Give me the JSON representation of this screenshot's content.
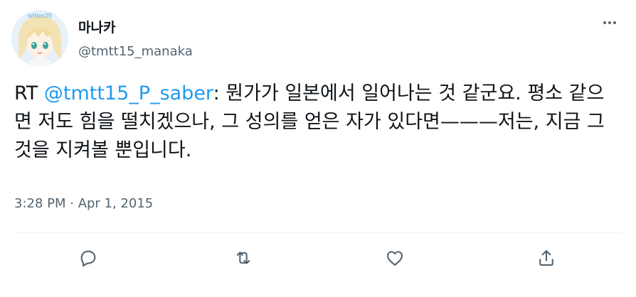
{
  "user": {
    "display_name": "마나카",
    "handle": "@tmtt15_manaka",
    "avatar_badge": "witter20"
  },
  "tweet": {
    "prefix": "RT ",
    "mention": "@tmtt15_P_saber",
    "body": ": 뭔가가 일본에서 일어나는 것 같군요. 평소 같으면 저도 힘을 떨치겠으나, 그 성의를 얻은 자가 있다면———저는, 지금 그것을 지켜볼 뿐입니다."
  },
  "meta": {
    "timestamp": "3:28 PM · Apr 1, 2015"
  },
  "actions": [
    {
      "name": "reply",
      "icon": "reply-icon"
    },
    {
      "name": "retweet",
      "icon": "retweet-icon"
    },
    {
      "name": "like",
      "icon": "heart-icon"
    },
    {
      "name": "share",
      "icon": "share-icon"
    }
  ],
  "colors": {
    "link": "#1d9bf0",
    "text": "#0f1419",
    "secondary": "#536471"
  }
}
